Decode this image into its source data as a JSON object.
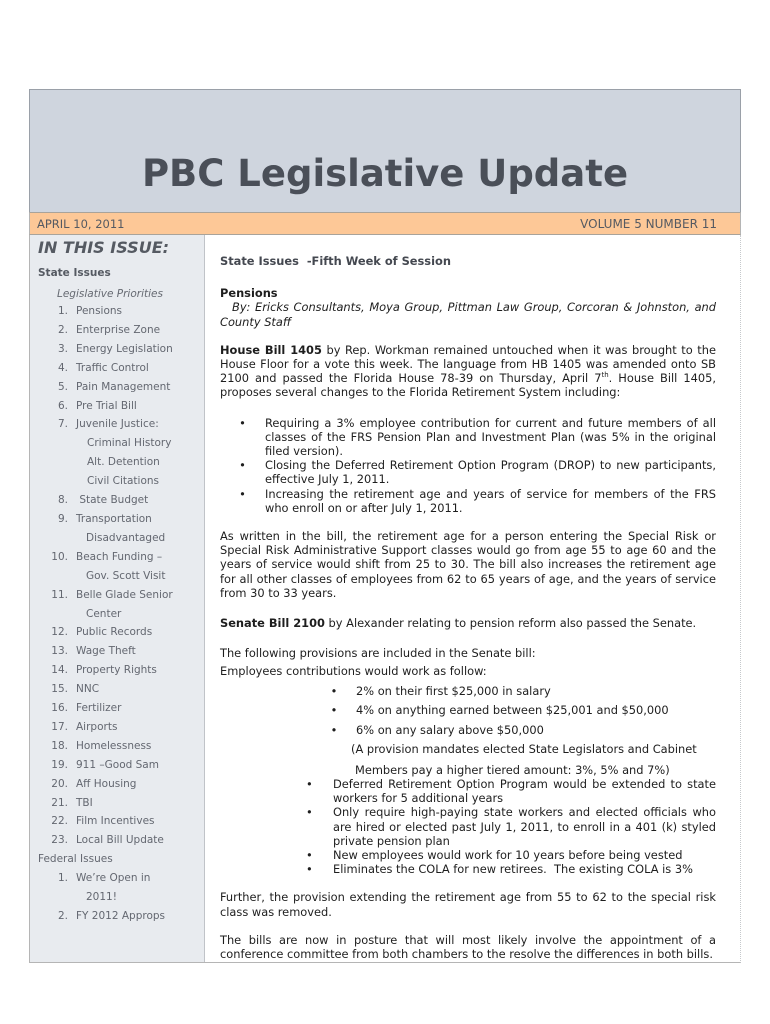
{
  "header": {
    "title": "PBC Legislative Update",
    "date": "APRIL 10, 2011",
    "volume": "VOLUME 5 NUMBER 11"
  },
  "colors": {
    "masthead_bg": "#cfd5de",
    "dateline_bg": "#fdc897",
    "sidebar_bg": "#e8ebef",
    "title_text": "#4a4f58"
  },
  "sidebar": {
    "heading": "IN THIS ISSUE:",
    "state_section": "State Issues",
    "state_subsection": "Legislative Priorities",
    "state_items": [
      {
        "num": "1.",
        "label": "Pensions"
      },
      {
        "num": "2.",
        "label": "Enterprise Zone"
      },
      {
        "num": "3.",
        "label": "Energy Legislation"
      },
      {
        "num": "4.",
        "label": "Traffic Control"
      },
      {
        "num": "5.",
        "label": "Pain Management"
      },
      {
        "num": "6.",
        "label": "Pre Trial Bill"
      },
      {
        "num": "7.",
        "label": "Juvenile Justice:"
      }
    ],
    "juvenile_sub": [
      "Criminal History",
      "Alt. Detention",
      "Civil Citations"
    ],
    "state_items_b": [
      {
        "num": "8.",
        "label": " State Budget"
      },
      {
        "num": "9.",
        "label": "Transportation",
        "cont": "Disadvantaged"
      },
      {
        "num": "10.",
        "label": "Beach Funding –",
        "cont": "Gov. Scott Visit"
      },
      {
        "num": "11.",
        "label": "Belle Glade Senior",
        "cont": "Center"
      },
      {
        "num": "12.",
        "label": "Public Records"
      },
      {
        "num": "13.",
        "label": "Wage Theft"
      },
      {
        "num": "14.",
        "label": "Property Rights"
      },
      {
        "num": "15.",
        "label": "NNC"
      },
      {
        "num": "16.",
        "label": "Fertilizer"
      },
      {
        "num": "17.",
        "label": "Airports"
      },
      {
        "num": "18.",
        "label": "Homelessness"
      },
      {
        "num": "19.",
        "label": "911 –Good Sam"
      },
      {
        "num": "20.",
        "label": "Aff Housing"
      },
      {
        "num": "21.",
        "label": "TBI"
      },
      {
        "num": "22.",
        "label": "Film Incentives"
      },
      {
        "num": "23.",
        "label": "Local Bill Update"
      }
    ],
    "federal_section": "Federal Issues",
    "federal_items": [
      {
        "num": "1.",
        "label": "We’re Open in",
        "cont": "2011!"
      },
      {
        "num": "2.",
        "label": "FY 2012 Approps"
      }
    ]
  },
  "article": {
    "kicker": "State Issues  -Fifth Week of Session",
    "section_title": "Pensions",
    "byline": "By: Ericks Consultants, Moya Group, Pittman Law Group, Corcoran & Johnston, and County Staff",
    "hb_bold": "House Bill 1405",
    "hb_text_1": " by Rep. Workman remained untouched when it was brought to the House Floor for a vote this week.  The language from HB 1405 was amended onto SB 2100 and passed the Florida House 78-39 on Thursday, April 7",
    "hb_sup": "th",
    "hb_text_2": ".  House Bill 1405, proposes several changes to the Florida Retirement System including:",
    "hb_bullets": [
      "Requiring a 3% employee contribution for current and future members of all classes of the FRS Pension Plan and Investment Plan (was 5% in the original filed version).",
      "Closing the Deferred Retirement Option Program (DROP) to new participants, effective July 1, 2011.",
      "Increasing the retirement age and years of service for members of the FRS who enroll on or after July 1, 2011."
    ],
    "special_risk_para": "As written in the bill, the retirement age for a person entering the Special Risk or Special Risk Administrative Support classes would go from age 55 to age 60 and the years of service would shift from 25 to 30. The bill also increases the retirement age for all other classes of employees from 62 to 65 years of age, and the years of service from 30 to 33 years.",
    "sb_bold": "Senate Bill 2100",
    "sb_text": " by Alexander relating to pension reform also passed the Senate.",
    "provisions_intro": "The following provisions are included in the Senate bill:",
    "contrib_intro": "Employees contributions would work as follow:",
    "tiers": [
      "2% on their first $25,000 in salary",
      "4% on anything earned between $25,001 and $50,000",
      "6% on any salary above $50,000"
    ],
    "provision_note_1": "(A provision mandates elected State Legislators and Cabinet",
    "provision_note_2": "Members pay a higher tiered amount: 3%, 5% and 7%)",
    "sb_bullets": [
      "Deferred Retirement Option Program would be extended to state workers for 5 additional years",
      "Only require high-paying state workers and elected officials who are hired or elected past July 1, 2011, to enroll in a 401 (k) styled private pension plan",
      "New employees would work for 10 years before being vested",
      "Eliminates the COLA for new retirees.  The existing COLA is 3%"
    ],
    "further_para": "Further, the provision extending the retirement age from 55 to 62 to the special risk class was removed.",
    "closing_para": "The bills are now in posture that will most likely involve the appointment of a conference committee from both chambers to the resolve the differences in both bills."
  }
}
